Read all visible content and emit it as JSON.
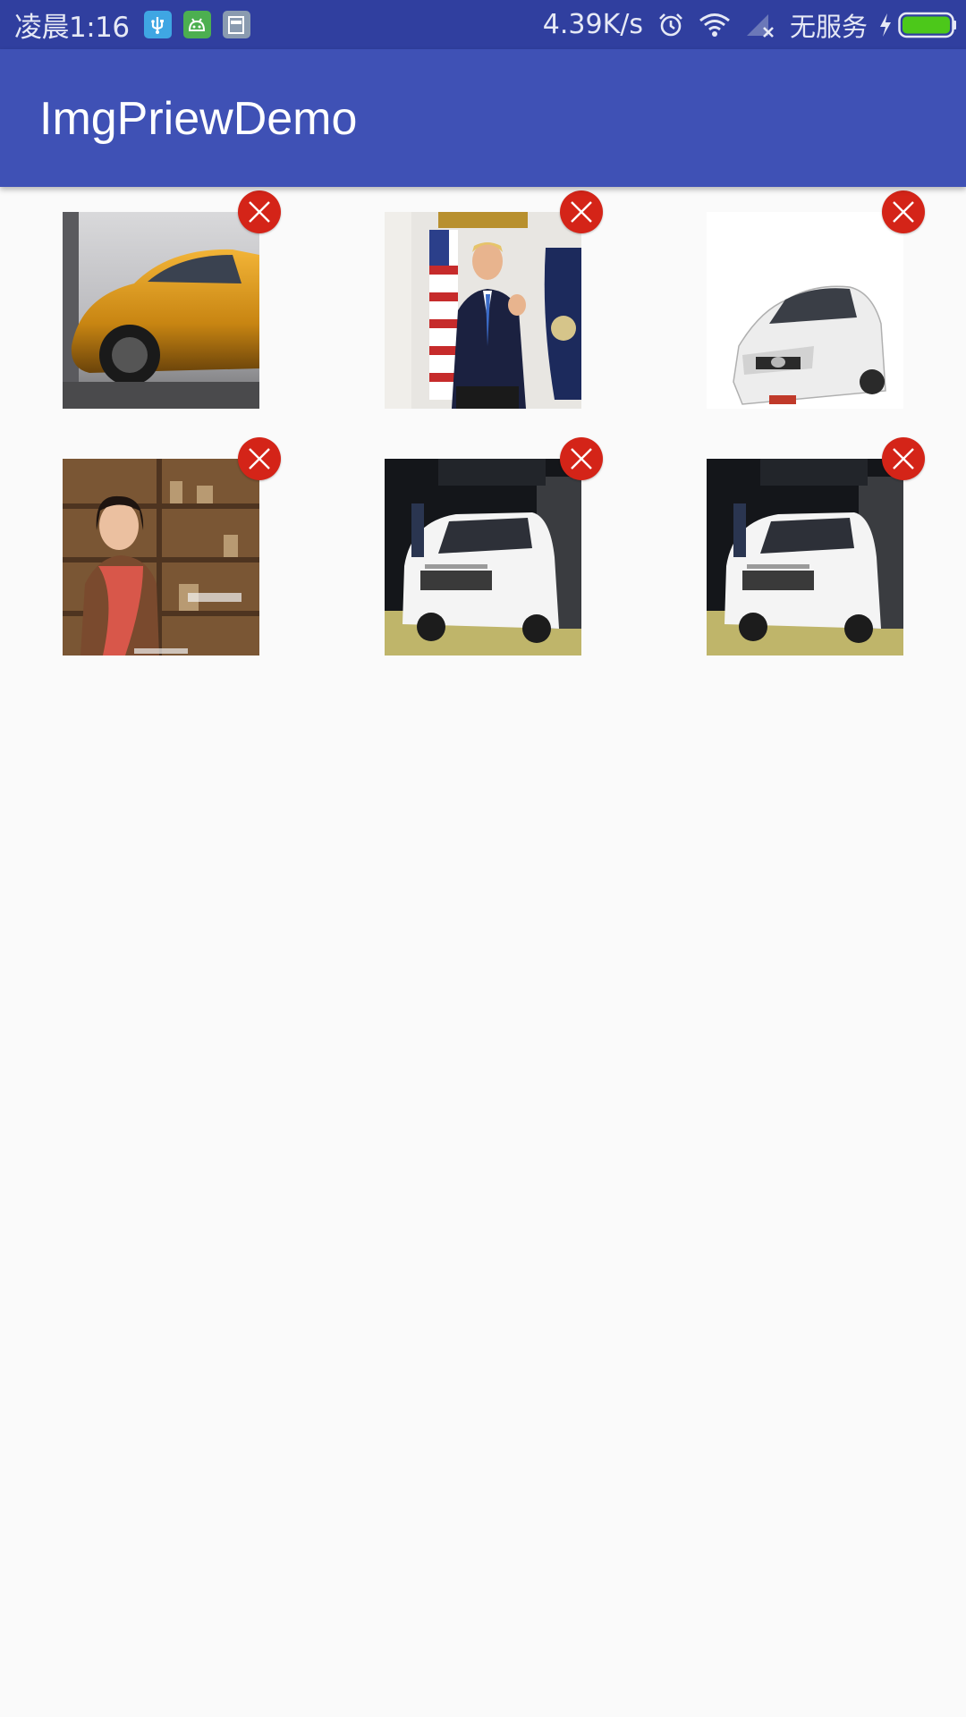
{
  "status_bar": {
    "time": "凌晨1:16",
    "net_speed": "4.39K/s",
    "service": "无服务",
    "notification_icons": [
      "usb-icon",
      "android-debug-icon",
      "app-icon"
    ],
    "system_icons": [
      "alarm-icon",
      "wifi-icon",
      "no-signal-icon",
      "charging-icon",
      "battery-icon"
    ],
    "battery_color": "#4CC81A"
  },
  "app_bar": {
    "title": "ImgPriewDemo",
    "color": "#3F51B5",
    "status_color": "#303F9F"
  },
  "images": [
    {
      "subject": "orange sports car",
      "delete_icon": "close-icon"
    },
    {
      "subject": "person at podium with flags",
      "delete_icon": "close-icon"
    },
    {
      "subject": "white sedan",
      "delete_icon": "close-icon"
    },
    {
      "subject": "woman seated before bookshelf",
      "delete_icon": "close-icon"
    },
    {
      "subject": "white SUV at auto show",
      "delete_icon": "close-icon"
    },
    {
      "subject": "white SUV at auto show",
      "delete_icon": "close-icon"
    }
  ],
  "colors": {
    "delete_button": "#D42418",
    "background": "#FAFAFA"
  }
}
